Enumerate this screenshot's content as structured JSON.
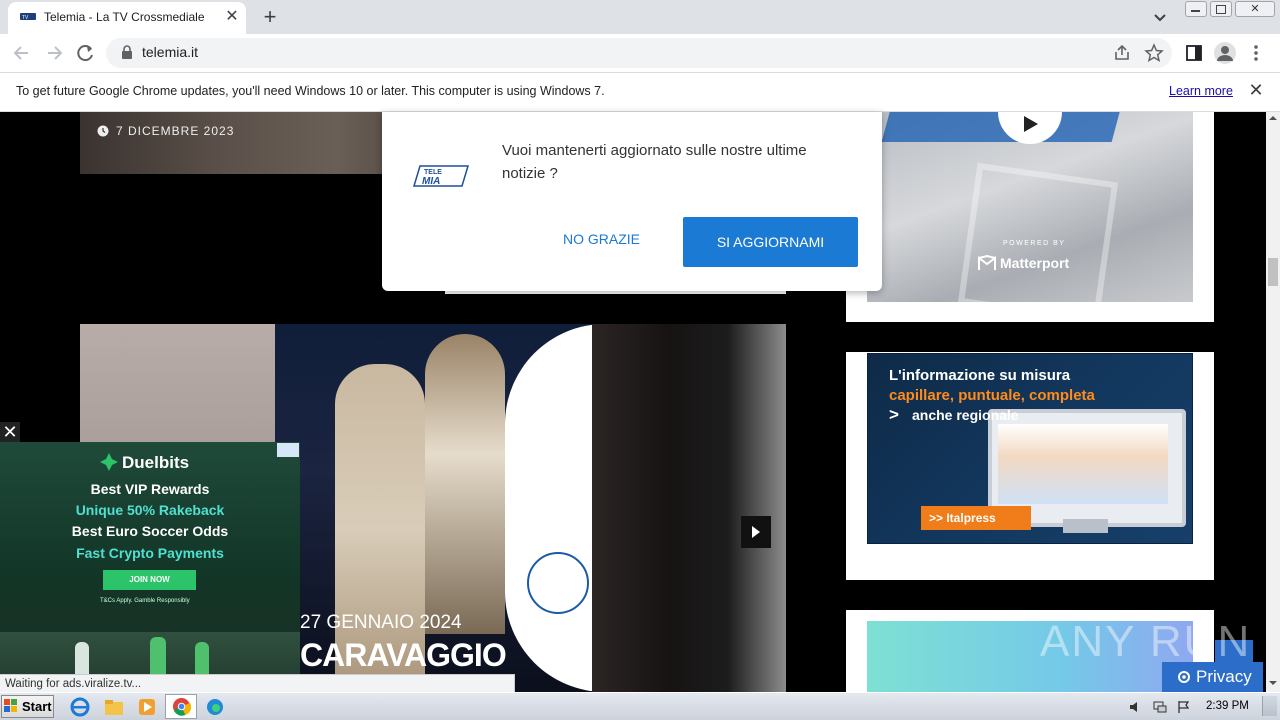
{
  "browser": {
    "tab_title": "Telemia - La TV Crossmediale",
    "url": "telemia.it",
    "infobar_text": "To get future Google Chrome updates, you'll need Windows 10 or later. This computer is using Windows 7.",
    "infobar_link": "Learn more",
    "status_text": "Waiting for ads.viralize.tv..."
  },
  "article": {
    "date": "7 DICEMBRE 2023"
  },
  "popup": {
    "message": "Vuoi mantenerti aggiornato sulle nostre ultime notizie ?",
    "decline_label": "NO GRAZIE",
    "accept_label": "SI AGGIORNAMI",
    "logo_text": "TELE MIA"
  },
  "sidebar": {
    "matterport_caption": "POWERED BY",
    "matterport_brand": "Matterport",
    "italpress_line1": "L'informazione su misura",
    "italpress_line2": "capillare, puntuale, completa",
    "italpress_line3": "anche regionale",
    "italpress_badge": ">> Italpress"
  },
  "carousel": {
    "event_date": "27 GENNAIO 2024",
    "event_title": "CARAVAGGIO"
  },
  "ad": {
    "brand": "Duelbits",
    "line1": "Best VIP Rewards",
    "line2": "Unique 50% Rakeback",
    "line3": "Best Euro Soccer Odds",
    "line4": "Fast Crypto Payments",
    "join_label": "JOIN NOW",
    "terms": "T&Cs Apply.   Gamble Responsibly",
    "close": "✕"
  },
  "widgets": {
    "privacy_label": "Privacy",
    "watermark": "ANY RUN"
  },
  "taskbar": {
    "start_label": "Start",
    "time": "2:39 PM"
  },
  "colors": {
    "accent_blue": "#1b7ad4",
    "italpress_orange": "#ff8c1a",
    "ad_green": "#2bc46b",
    "ad_cyan": "#4fe0d0"
  }
}
